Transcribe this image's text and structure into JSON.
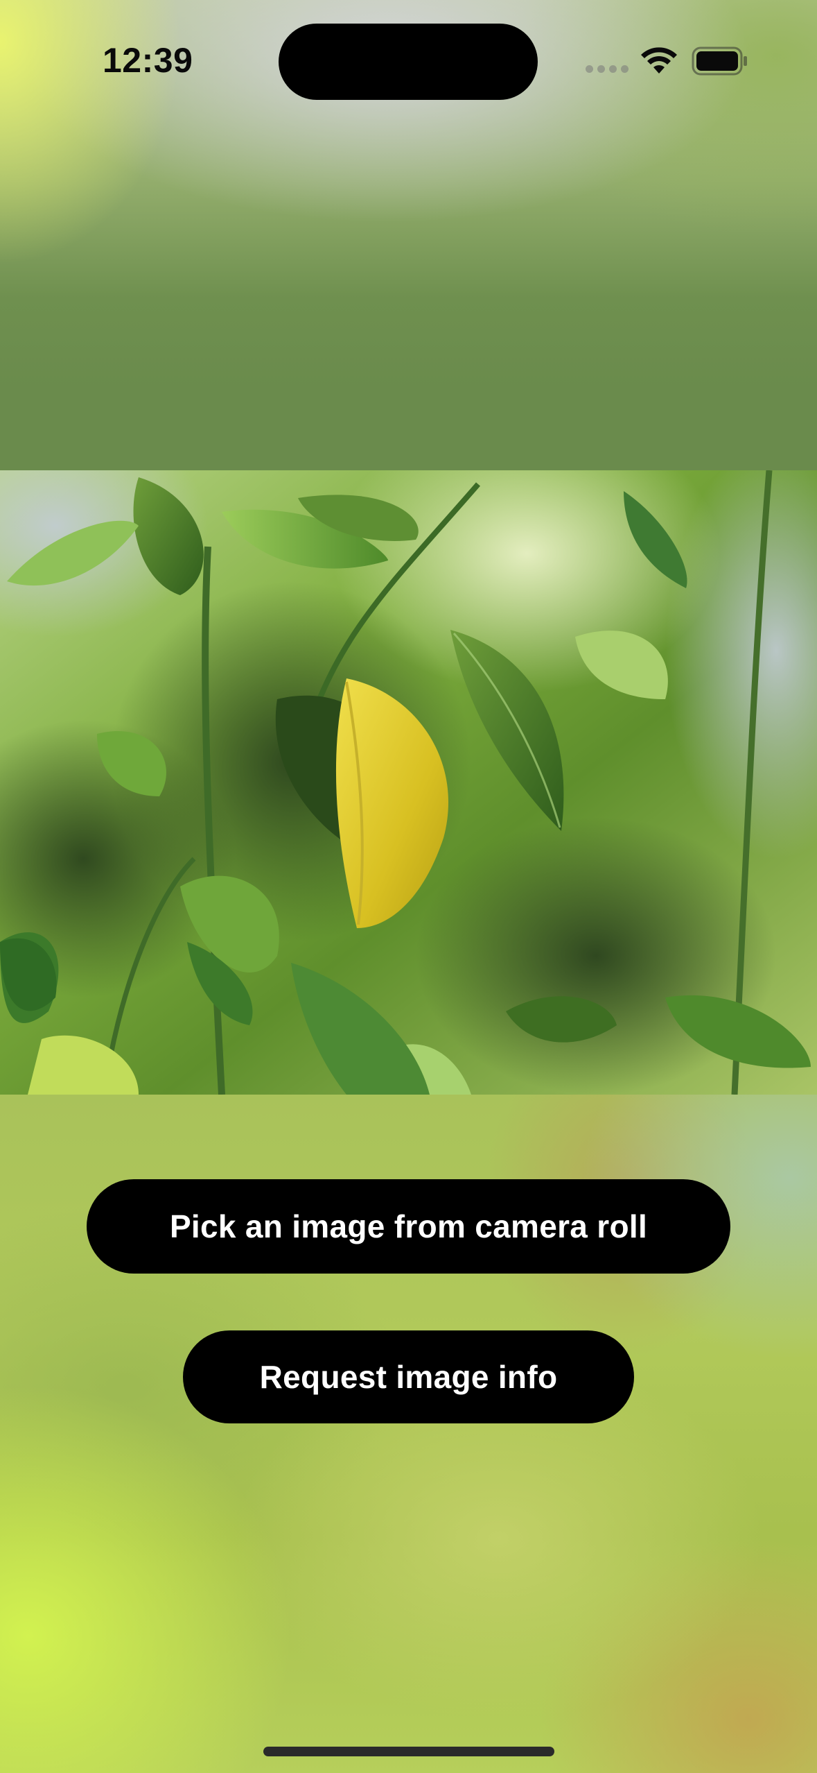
{
  "status_bar": {
    "time": "12:39",
    "icons": [
      "cellular-signal-icon",
      "wifi-icon",
      "battery-icon"
    ]
  },
  "photo": {
    "subject": "leaf-photo"
  },
  "actions": {
    "pick_image_label": "Pick an image from camera roll",
    "request_info_label": "Request image info"
  },
  "colors": {
    "button_bg": "#000000",
    "button_text": "#ffffff",
    "leaf_highlight": "#e3c62a"
  }
}
